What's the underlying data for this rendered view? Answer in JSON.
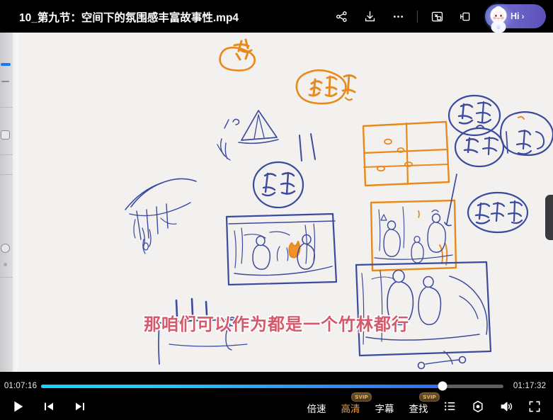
{
  "window": {
    "title": "10_第九节：空间下的氛围感丰富故事性.mp4"
  },
  "top_actions": {
    "share_label": "share-icon",
    "download_label": "download-icon",
    "more_label": "more-icon",
    "pip_label": "picture-in-picture-icon",
    "cast_label": "cast-icon",
    "greeting": "Hi",
    "greeting_chevron": "›"
  },
  "player": {
    "current_time": "01:07:16",
    "duration": "01:17:32",
    "progress_percent": 86.8,
    "subtitle": "那咱们可以作为都是一个竹林都行",
    "play_state": "paused"
  },
  "controls": {
    "play_label": "play-button",
    "prev_label": "previous-button",
    "next_label": "next-button",
    "speed_label": "倍速",
    "quality_label": "高清",
    "subtitle_label": "字幕",
    "search_label": "查找",
    "quality_badge": "SVIP",
    "search_badge": "SVIP",
    "playlist_label": "playlist-icon",
    "settings_label": "settings-icon",
    "volume_label": "volume-icon",
    "fullscreen_label": "fullscreen-icon"
  },
  "colors": {
    "accent_blue": "#2e8bfb",
    "accent_cyan": "#19d3ff",
    "vip_gold": "#f0a23c",
    "subtitle_pink": "#d4596b",
    "ink_blue": "#3b4a9c",
    "ink_orange": "#e8891c",
    "canvas_bg": "#f2f1ef"
  },
  "whiteboard": {
    "description": "hand-drawn storyboard whiteboard with orange and blue ink sketches"
  }
}
